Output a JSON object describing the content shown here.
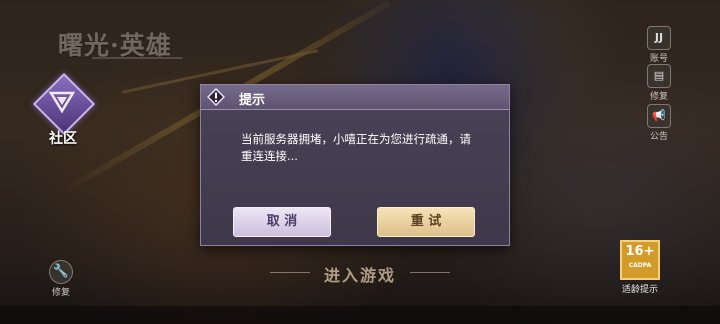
{
  "logo": {
    "text": "曙光·英雄"
  },
  "community": {
    "label": "社区"
  },
  "right_menu": [
    {
      "icon": "account-icon",
      "glyph": "JJ",
      "label": "账号"
    },
    {
      "icon": "notebook-icon",
      "glyph": "▤",
      "label": "修复"
    },
    {
      "icon": "megaphone-icon",
      "glyph": "📢",
      "label": "公告"
    }
  ],
  "age_rating": {
    "badge": "16+",
    "sub": "CADPA",
    "label": "适龄提示"
  },
  "settings": {
    "label": "修复"
  },
  "enter_game": {
    "label": "进入游戏"
  },
  "dialog": {
    "title": "提示",
    "message": "当前服务器拥堵，小嘻正在为您进行疏通，请重连连接...",
    "cancel_label": "取 消",
    "retry_label": "重 试"
  },
  "colors": {
    "dialog_bg": "#433b50",
    "cancel_bg": "#ddd3ea",
    "retry_bg": "#e9cf9c",
    "community_accent": "#7b5fb2"
  }
}
